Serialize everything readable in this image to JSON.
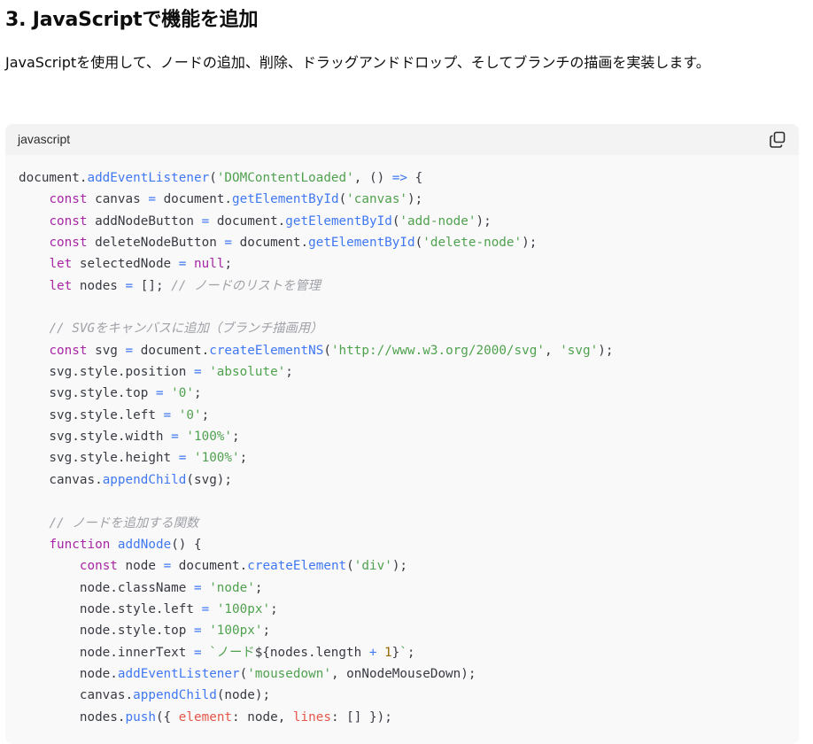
{
  "heading": "3. JavaScriptで機能を追加",
  "description": "JavaScriptを使用して、ノードの追加、削除、ドラッグアンドドロップ、そしてブランチの描画を実装します。",
  "code_block": {
    "language": "javascript",
    "copy_icon": "copy-icon",
    "lines": [
      [
        [
          "plain",
          "document."
        ],
        [
          "fn",
          "addEventListener"
        ],
        [
          "plain",
          "("
        ],
        [
          "str",
          "'DOMContentLoaded'"
        ],
        [
          "plain",
          ", () "
        ],
        [
          "op",
          "=>"
        ],
        [
          "plain",
          " {"
        ]
      ],
      [
        [
          "plain",
          "    "
        ],
        [
          "kw",
          "const"
        ],
        [
          "plain",
          " canvas "
        ],
        [
          "op",
          "="
        ],
        [
          "plain",
          " document."
        ],
        [
          "fn",
          "getElementById"
        ],
        [
          "plain",
          "("
        ],
        [
          "str",
          "'canvas'"
        ],
        [
          "plain",
          ");"
        ]
      ],
      [
        [
          "plain",
          "    "
        ],
        [
          "kw",
          "const"
        ],
        [
          "plain",
          " addNodeButton "
        ],
        [
          "op",
          "="
        ],
        [
          "plain",
          " document."
        ],
        [
          "fn",
          "getElementById"
        ],
        [
          "plain",
          "("
        ],
        [
          "str",
          "'add-node'"
        ],
        [
          "plain",
          ");"
        ]
      ],
      [
        [
          "plain",
          "    "
        ],
        [
          "kw",
          "const"
        ],
        [
          "plain",
          " deleteNodeButton "
        ],
        [
          "op",
          "="
        ],
        [
          "plain",
          " document."
        ],
        [
          "fn",
          "getElementById"
        ],
        [
          "plain",
          "("
        ],
        [
          "str",
          "'delete-node'"
        ],
        [
          "plain",
          ");"
        ]
      ],
      [
        [
          "plain",
          "    "
        ],
        [
          "kw",
          "let"
        ],
        [
          "plain",
          " selectedNode "
        ],
        [
          "op",
          "="
        ],
        [
          "plain",
          " "
        ],
        [
          "kw",
          "null"
        ],
        [
          "plain",
          ";"
        ]
      ],
      [
        [
          "plain",
          "    "
        ],
        [
          "kw",
          "let"
        ],
        [
          "plain",
          " nodes "
        ],
        [
          "op",
          "="
        ],
        [
          "plain",
          " []; "
        ],
        [
          "cmt",
          "// ノードのリストを管理"
        ]
      ],
      [],
      [
        [
          "plain",
          "    "
        ],
        [
          "cmt",
          "// SVGをキャンバスに追加（ブランチ描画用）"
        ]
      ],
      [
        [
          "plain",
          "    "
        ],
        [
          "kw",
          "const"
        ],
        [
          "plain",
          " svg "
        ],
        [
          "op",
          "="
        ],
        [
          "plain",
          " document."
        ],
        [
          "fn",
          "createElementNS"
        ],
        [
          "plain",
          "("
        ],
        [
          "str",
          "'http://www.w3.org/2000/svg'"
        ],
        [
          "plain",
          ", "
        ],
        [
          "str",
          "'svg'"
        ],
        [
          "plain",
          ");"
        ]
      ],
      [
        [
          "plain",
          "    svg.style.position "
        ],
        [
          "op",
          "="
        ],
        [
          "plain",
          " "
        ],
        [
          "str",
          "'absolute'"
        ],
        [
          "plain",
          ";"
        ]
      ],
      [
        [
          "plain",
          "    svg.style.top "
        ],
        [
          "op",
          "="
        ],
        [
          "plain",
          " "
        ],
        [
          "str",
          "'0'"
        ],
        [
          "plain",
          ";"
        ]
      ],
      [
        [
          "plain",
          "    svg.style.left "
        ],
        [
          "op",
          "="
        ],
        [
          "plain",
          " "
        ],
        [
          "str",
          "'0'"
        ],
        [
          "plain",
          ";"
        ]
      ],
      [
        [
          "plain",
          "    svg.style.width "
        ],
        [
          "op",
          "="
        ],
        [
          "plain",
          " "
        ],
        [
          "str",
          "'100%'"
        ],
        [
          "plain",
          ";"
        ]
      ],
      [
        [
          "plain",
          "    svg.style.height "
        ],
        [
          "op",
          "="
        ],
        [
          "plain",
          " "
        ],
        [
          "str",
          "'100%'"
        ],
        [
          "plain",
          ";"
        ]
      ],
      [
        [
          "plain",
          "    canvas."
        ],
        [
          "fn",
          "appendChild"
        ],
        [
          "plain",
          "(svg);"
        ]
      ],
      [],
      [
        [
          "plain",
          "    "
        ],
        [
          "cmt",
          "// ノードを追加する関数"
        ]
      ],
      [
        [
          "plain",
          "    "
        ],
        [
          "kw",
          "function"
        ],
        [
          "plain",
          " "
        ],
        [
          "fn",
          "addNode"
        ],
        [
          "plain",
          "() {"
        ]
      ],
      [
        [
          "plain",
          "        "
        ],
        [
          "kw",
          "const"
        ],
        [
          "plain",
          " node "
        ],
        [
          "op",
          "="
        ],
        [
          "plain",
          " document."
        ],
        [
          "fn",
          "createElement"
        ],
        [
          "plain",
          "("
        ],
        [
          "str",
          "'div'"
        ],
        [
          "plain",
          ");"
        ]
      ],
      [
        [
          "plain",
          "        node.className "
        ],
        [
          "op",
          "="
        ],
        [
          "plain",
          " "
        ],
        [
          "str",
          "'node'"
        ],
        [
          "plain",
          ";"
        ]
      ],
      [
        [
          "plain",
          "        node.style.left "
        ],
        [
          "op",
          "="
        ],
        [
          "plain",
          " "
        ],
        [
          "str",
          "'100px'"
        ],
        [
          "plain",
          ";"
        ]
      ],
      [
        [
          "plain",
          "        node.style.top "
        ],
        [
          "op",
          "="
        ],
        [
          "plain",
          " "
        ],
        [
          "str",
          "'100px'"
        ],
        [
          "plain",
          ";"
        ]
      ],
      [
        [
          "plain",
          "        node.innerText "
        ],
        [
          "op",
          "="
        ],
        [
          "plain",
          " "
        ],
        [
          "str",
          "`ノード"
        ],
        [
          "plain",
          "${nodes.length "
        ],
        [
          "op",
          "+"
        ],
        [
          "plain",
          " "
        ],
        [
          "num",
          "1"
        ],
        [
          "plain",
          "}"
        ],
        [
          "str",
          "`"
        ],
        [
          "plain",
          ";"
        ]
      ],
      [
        [
          "plain",
          "        node."
        ],
        [
          "fn",
          "addEventListener"
        ],
        [
          "plain",
          "("
        ],
        [
          "str",
          "'mousedown'"
        ],
        [
          "plain",
          ", onNodeMouseDown);"
        ]
      ],
      [
        [
          "plain",
          "        canvas."
        ],
        [
          "fn",
          "appendChild"
        ],
        [
          "plain",
          "(node);"
        ]
      ],
      [
        [
          "plain",
          "        nodes."
        ],
        [
          "fn",
          "push"
        ],
        [
          "plain",
          "({ "
        ],
        [
          "prop",
          "element"
        ],
        [
          "plain",
          ": node, "
        ],
        [
          "prop",
          "lines"
        ],
        [
          "plain",
          ": [] });"
        ]
      ]
    ]
  }
}
